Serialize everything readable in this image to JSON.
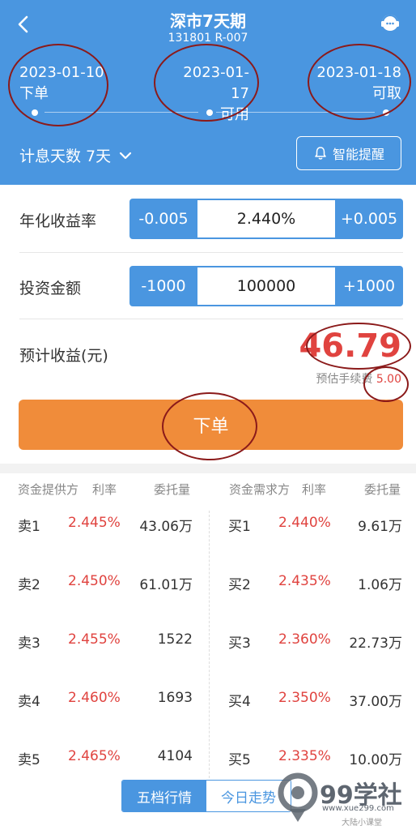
{
  "header": {
    "title": "深市7天期",
    "subtitle": "131801 R-007"
  },
  "dates": [
    {
      "date": "2023-01-10",
      "label": "下单"
    },
    {
      "date": "2023-01-17",
      "label": "可用"
    },
    {
      "date": "2023-01-18",
      "label": "可取"
    }
  ],
  "interest": {
    "label": "计息天数 7天"
  },
  "remind": {
    "label": "智能提醒"
  },
  "rate_row": {
    "label": "年化收益率",
    "minus": "-0.005",
    "value": "2.440%",
    "plus": "+0.005"
  },
  "amount_row": {
    "label": "投资金额",
    "minus": "-1000",
    "value": "100000",
    "plus": "+1000"
  },
  "profit": {
    "label": "预计收益(元)",
    "value": "46.79",
    "fee_label": "预估手续费",
    "fee_value": "5.00"
  },
  "submit": {
    "label": "下单"
  },
  "book": {
    "left_headers": [
      "资金提供方",
      "利率",
      "委托量"
    ],
    "right_headers": [
      "资金需求方",
      "利率",
      "委托量"
    ],
    "sell": [
      {
        "name": "卖1",
        "rate": "2.445%",
        "qty": "43.06万"
      },
      {
        "name": "卖2",
        "rate": "2.450%",
        "qty": "61.01万"
      },
      {
        "name": "卖3",
        "rate": "2.455%",
        "qty": "1522"
      },
      {
        "name": "卖4",
        "rate": "2.460%",
        "qty": "1693"
      },
      {
        "name": "卖5",
        "rate": "2.465%",
        "qty": "4104"
      }
    ],
    "buy": [
      {
        "name": "买1",
        "rate": "2.440%",
        "qty": "9.61万"
      },
      {
        "name": "买2",
        "rate": "2.435%",
        "qty": "1.06万"
      },
      {
        "name": "买3",
        "rate": "2.360%",
        "qty": "22.73万"
      },
      {
        "name": "买4",
        "rate": "2.350%",
        "qty": "37.00万"
      },
      {
        "name": "买5",
        "rate": "2.335%",
        "qty": "10.00万"
      }
    ]
  },
  "tabs": [
    {
      "label": "五档行情",
      "active": true
    },
    {
      "label": "今日走势",
      "active": false
    }
  ],
  "watermark": {
    "brand": "99学社",
    "url": "www.xue299.com",
    "note": "大陆小课堂"
  },
  "colors": {
    "header_blue": "#4a96e0",
    "button_orange": "#f08c3a",
    "red": "#e0433f",
    "annotation": "#8b1a1a"
  }
}
